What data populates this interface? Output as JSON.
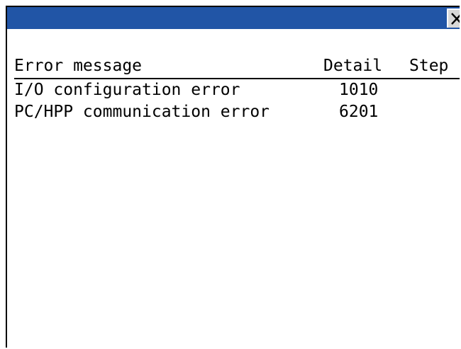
{
  "window": {
    "close_glyph": "X",
    "title_bar_color": "#2155a6"
  },
  "table": {
    "columns": {
      "message": "Error message",
      "detail": "Detail",
      "step": "Step"
    },
    "rows": [
      {
        "message": "I/O configuration error",
        "detail": "1010",
        "step": ""
      },
      {
        "message": "PC/HPP communication error",
        "detail": "6201",
        "step": ""
      }
    ]
  }
}
